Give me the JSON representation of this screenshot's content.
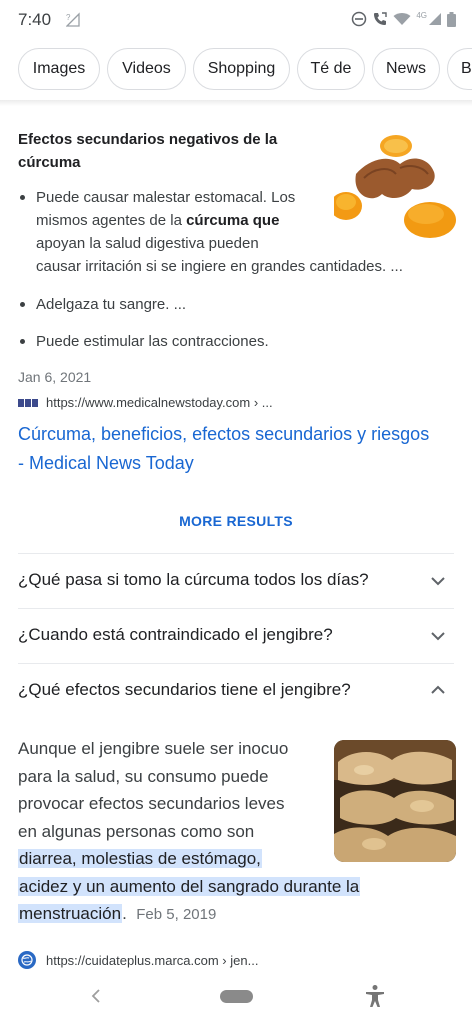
{
  "status_bar": {
    "time": "7:40",
    "network_label": "4G"
  },
  "chips": [
    "Images",
    "Videos",
    "Shopping",
    "Té de",
    "News",
    "B"
  ],
  "featured_snippet": {
    "title_line1": "Efectos secundarios negativos de la",
    "title_line2": "cúrcuma",
    "image_icon": "turmeric-photo",
    "bullet1_line1": "Puede causar malestar estomacal. Los",
    "bullet1_line2_pre": "mismos agentes de la ",
    "bullet1_line2_bold": "cúrcuma que",
    "bullet1_line3": "apoyan la salud digestiva pueden",
    "bullet1_line4": "causar irritación si se ingiere en grandes cantidades. ...",
    "bullet2": "Adelgaza tu sangre. ...",
    "bullet3": "Puede estimular las contracciones.",
    "date": "Jan 6, 2021",
    "source_url": "https://www.medicalnewstoday.com › ...",
    "result_link_line1": "Cúrcuma, beneficios, efectos secundarios y riesgos",
    "result_link_line2": "- Medical News Today"
  },
  "more_results_label": "MORE RESULTS",
  "related_questions": [
    {
      "question": "¿Qué pasa si tomo la cúrcuma todos los días?",
      "expanded": false
    },
    {
      "question": "¿Cuando está contraindicado el jengibre?",
      "expanded": false
    },
    {
      "question": "¿Qué efectos secundarios tiene el jengibre?",
      "expanded": true
    }
  ],
  "answer": {
    "line1": "Aunque el jengibre suele ser inocuo",
    "line2": "para la salud, su consumo puede",
    "line3": "provocar efectos secundarios leves",
    "line4": "en algunas personas como son",
    "hl_line1": "diarrea, molestias de estómago,",
    "hl_line2": "acidez y un aumento del sangrado durante la",
    "hl_line3": "menstruación",
    "after_hl": ".",
    "date": "Feb 5, 2019",
    "image_icon": "ginger-photo",
    "source_url": "https://cuidateplus.marca.com › jen..."
  },
  "colors": {
    "link": "#1967d2",
    "highlight": "#d2e3fc",
    "secondary_text": "#70757a"
  }
}
